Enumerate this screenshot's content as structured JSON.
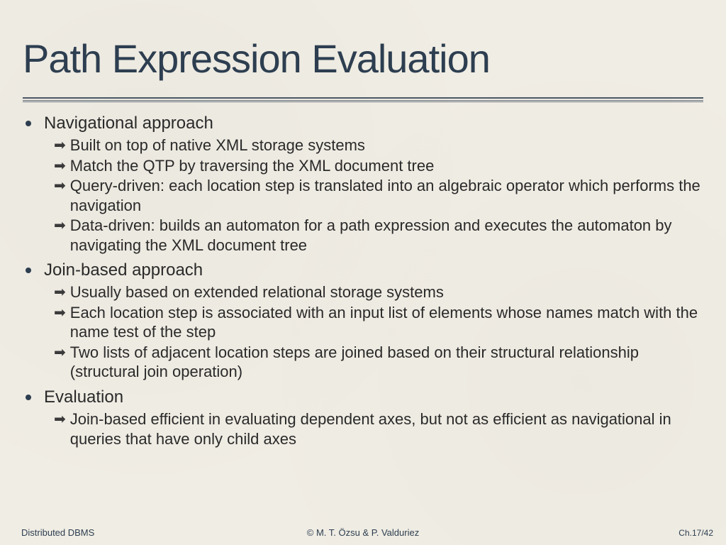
{
  "title": "Path Expression Evaluation",
  "sections": [
    {
      "heading": "Navigational approach",
      "items": [
        "Built on top of native XML storage systems",
        "Match the QTP by traversing the XML document tree",
        "Query-driven: each location step is translated into an algebraic operator which performs the navigation",
        "Data-driven: builds an automaton for a path expression and executes the automaton by navigating the XML document tree"
      ]
    },
    {
      "heading": "Join-based approach",
      "items": [
        "Usually based on extended relational storage systems",
        "Each location step is associated with an input list of elements whose names match with the name test of the step",
        "Two lists of adjacent location steps are joined based on their structural relationship (structural join operation)"
      ]
    },
    {
      "heading": "Evaluation",
      "items": [
        "Join-based efficient in evaluating dependent axes, but not as efficient as navigational in queries  that have only child axes"
      ]
    }
  ],
  "footer": {
    "left": "Distributed DBMS",
    "center": "© M. T. Özsu & P. Valduriez",
    "right": "Ch.17/42"
  }
}
